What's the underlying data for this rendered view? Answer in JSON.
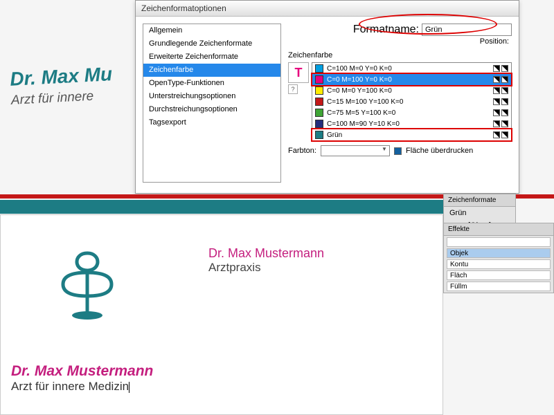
{
  "bg": {
    "line1": "Dr. Max Mu",
    "line2": "Arzt für innere"
  },
  "dialog": {
    "title": "Zeichenformatoptionen",
    "formatname_label": "Formatname:",
    "formatname_value": "Grün",
    "position_label": "Position:",
    "categories": [
      "Allgemein",
      "Grundlegende Zeichenformate",
      "Erweiterte Zeichenformate",
      "Zeichenfarbe",
      "OpenType-Funktionen",
      "Unterstreichungsoptionen",
      "Durchstreichungsoptionen",
      "Tagsexport"
    ],
    "cat_selected": 3,
    "section": "Zeichenfarbe",
    "t_glyph": "T",
    "q_glyph": "?",
    "swatches": [
      {
        "label": "C=100 M=0 Y=0 K=0",
        "color": "#009ee0"
      },
      {
        "label": "C=0 M=100 Y=0 K=0",
        "color": "#e6007e",
        "selected": true,
        "highlight": true
      },
      {
        "label": "C=0 M=0 Y=100 K=0",
        "color": "#ffed00"
      },
      {
        "label": "C=15 M=100 Y=100 K=0",
        "color": "#c41818"
      },
      {
        "label": "C=75 M=5 Y=100 K=0",
        "color": "#3fa535"
      },
      {
        "label": "C=100 M=90 Y=10 K=0",
        "color": "#232d7c"
      },
      {
        "label": "Grün",
        "color": "#1d7c84",
        "highlight": true
      }
    ],
    "farbton_label": "Farbton:",
    "overprint_label": "Fläche überdrucken"
  },
  "canvas": {
    "center1": "Dr. Max Mustermann",
    "center2": "Arztpraxis",
    "bottom1": "Dr. Max Mustermann",
    "bottom2": "Arzt für innere Medizin"
  },
  "panel_formats": {
    "tab": "Zeichenformate",
    "current": "Grün",
    "items": [
      "[Ohne]",
      "Grün"
    ],
    "selected": 1
  },
  "panel_effects": {
    "tab": "Effekte",
    "rows": [
      "Objek",
      "Kontu",
      "Fläch",
      "Füllm"
    ]
  }
}
